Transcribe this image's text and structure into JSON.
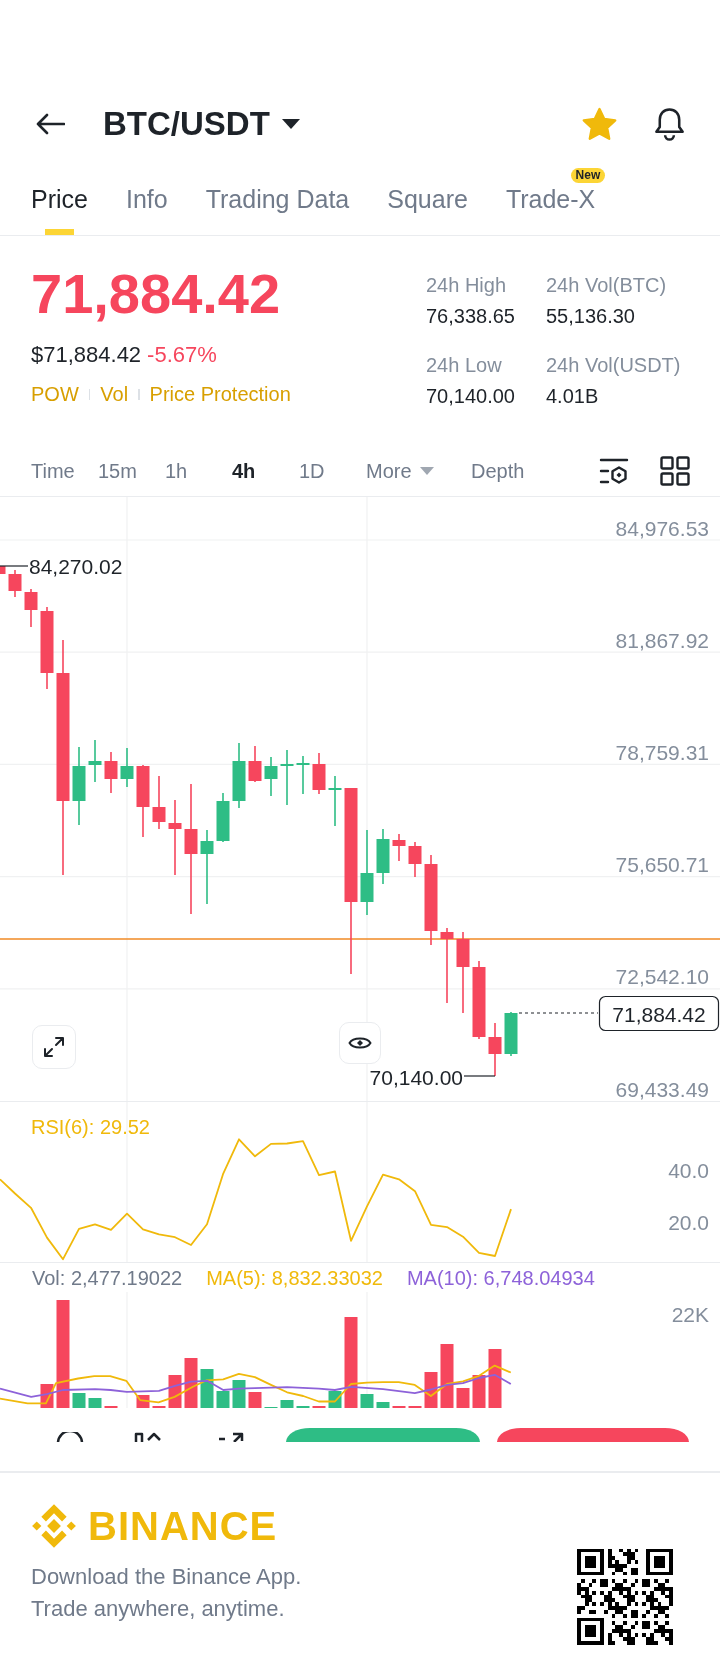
{
  "header": {
    "title": "BTC/USDT",
    "favorite": true
  },
  "tabs": [
    {
      "label": "Price",
      "selected": true
    },
    {
      "label": "Info",
      "selected": false
    },
    {
      "label": "Trading Data",
      "selected": false
    },
    {
      "label": "Square",
      "selected": false
    },
    {
      "label": "Trade-X",
      "selected": false,
      "badge": "New"
    }
  ],
  "ticker": {
    "price": "71,884.42",
    "price_usd": "$71,884.42",
    "change": "-5.67%",
    "down": true,
    "tags": [
      "POW",
      "Vol",
      "Price Protection"
    ]
  },
  "stats": [
    {
      "label": "24h High",
      "value": "76,338.65"
    },
    {
      "label": "24h Vol(BTC)",
      "value": "55,136.30"
    },
    {
      "label": "24h Low",
      "value": "70,140.00"
    },
    {
      "label": "24h Vol(USDT)",
      "value": "4.01B"
    }
  ],
  "intervals": [
    {
      "label": "Time",
      "kind": "tab",
      "selected": false
    },
    {
      "label": "15m",
      "kind": "tab",
      "selected": false
    },
    {
      "label": "1h",
      "kind": "tab",
      "selected": false
    },
    {
      "label": "4h",
      "kind": "tab",
      "selected": true
    },
    {
      "label": "1D",
      "kind": "tab",
      "selected": false
    },
    {
      "label": "More",
      "kind": "dropdown",
      "selected": false
    },
    {
      "label": "Depth",
      "kind": "tab",
      "selected": false
    }
  ],
  "price_chart": {
    "price_labels": [
      "84,976.53",
      "81,867.92",
      "78,759.31",
      "75,650.71",
      "72,542.10",
      "69,433.49"
    ],
    "high_marker": "84,270.02",
    "low_marker": "70,140.00",
    "last_price": "71,884.42"
  },
  "rsi": {
    "label": "RSI(6): 29.52",
    "axis_labels": [
      "40.0",
      "20.0"
    ]
  },
  "volume": {
    "legend": [
      {
        "label": "Vol: 2,477.19022",
        "color": "#707a8a"
      },
      {
        "label": "MA(5): 8,832.33032",
        "color": "#f0b90b"
      },
      {
        "label": "MA(10): 6,748.04934",
        "color": "#8d62d9"
      }
    ],
    "axis_label": "22K"
  },
  "footer": {
    "brand": "BINANCE",
    "lines": [
      "Download the Binance App.",
      "Trade anywhere, anytime."
    ]
  }
}
